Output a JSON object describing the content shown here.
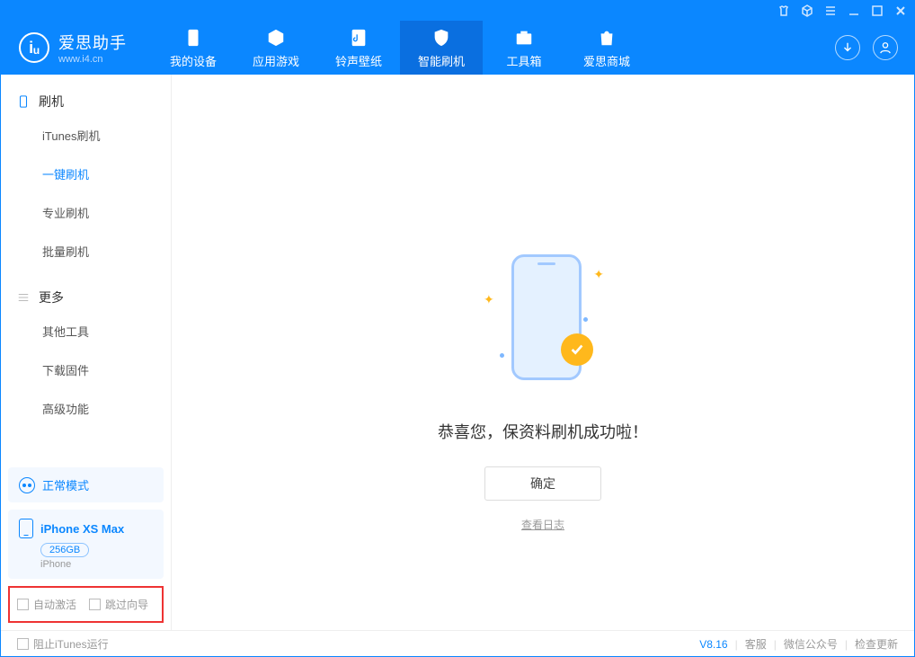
{
  "app": {
    "name_cn": "爱思助手",
    "name_en": "www.i4.cn"
  },
  "nav": {
    "tabs": [
      {
        "label": "我的设备"
      },
      {
        "label": "应用游戏"
      },
      {
        "label": "铃声壁纸"
      },
      {
        "label": "智能刷机"
      },
      {
        "label": "工具箱"
      },
      {
        "label": "爱思商城"
      }
    ]
  },
  "sidebar": {
    "group1": {
      "title": "刷机",
      "items": [
        "iTunes刷机",
        "一键刷机",
        "专业刷机",
        "批量刷机"
      ]
    },
    "group2": {
      "title": "更多",
      "items": [
        "其他工具",
        "下载固件",
        "高级功能"
      ]
    },
    "mode": "正常模式",
    "device": {
      "name": "iPhone XS Max",
      "capacity": "256GB",
      "type": "iPhone"
    },
    "checks": {
      "auto_activate": "自动激活",
      "skip_guide": "跳过向导"
    }
  },
  "main": {
    "message": "恭喜您，保资料刷机成功啦！",
    "ok": "确定",
    "log": "查看日志"
  },
  "footer": {
    "block_itunes": "阻止iTunes运行",
    "version": "V8.16",
    "service": "客服",
    "wechat": "微信公众号",
    "update": "检查更新"
  }
}
